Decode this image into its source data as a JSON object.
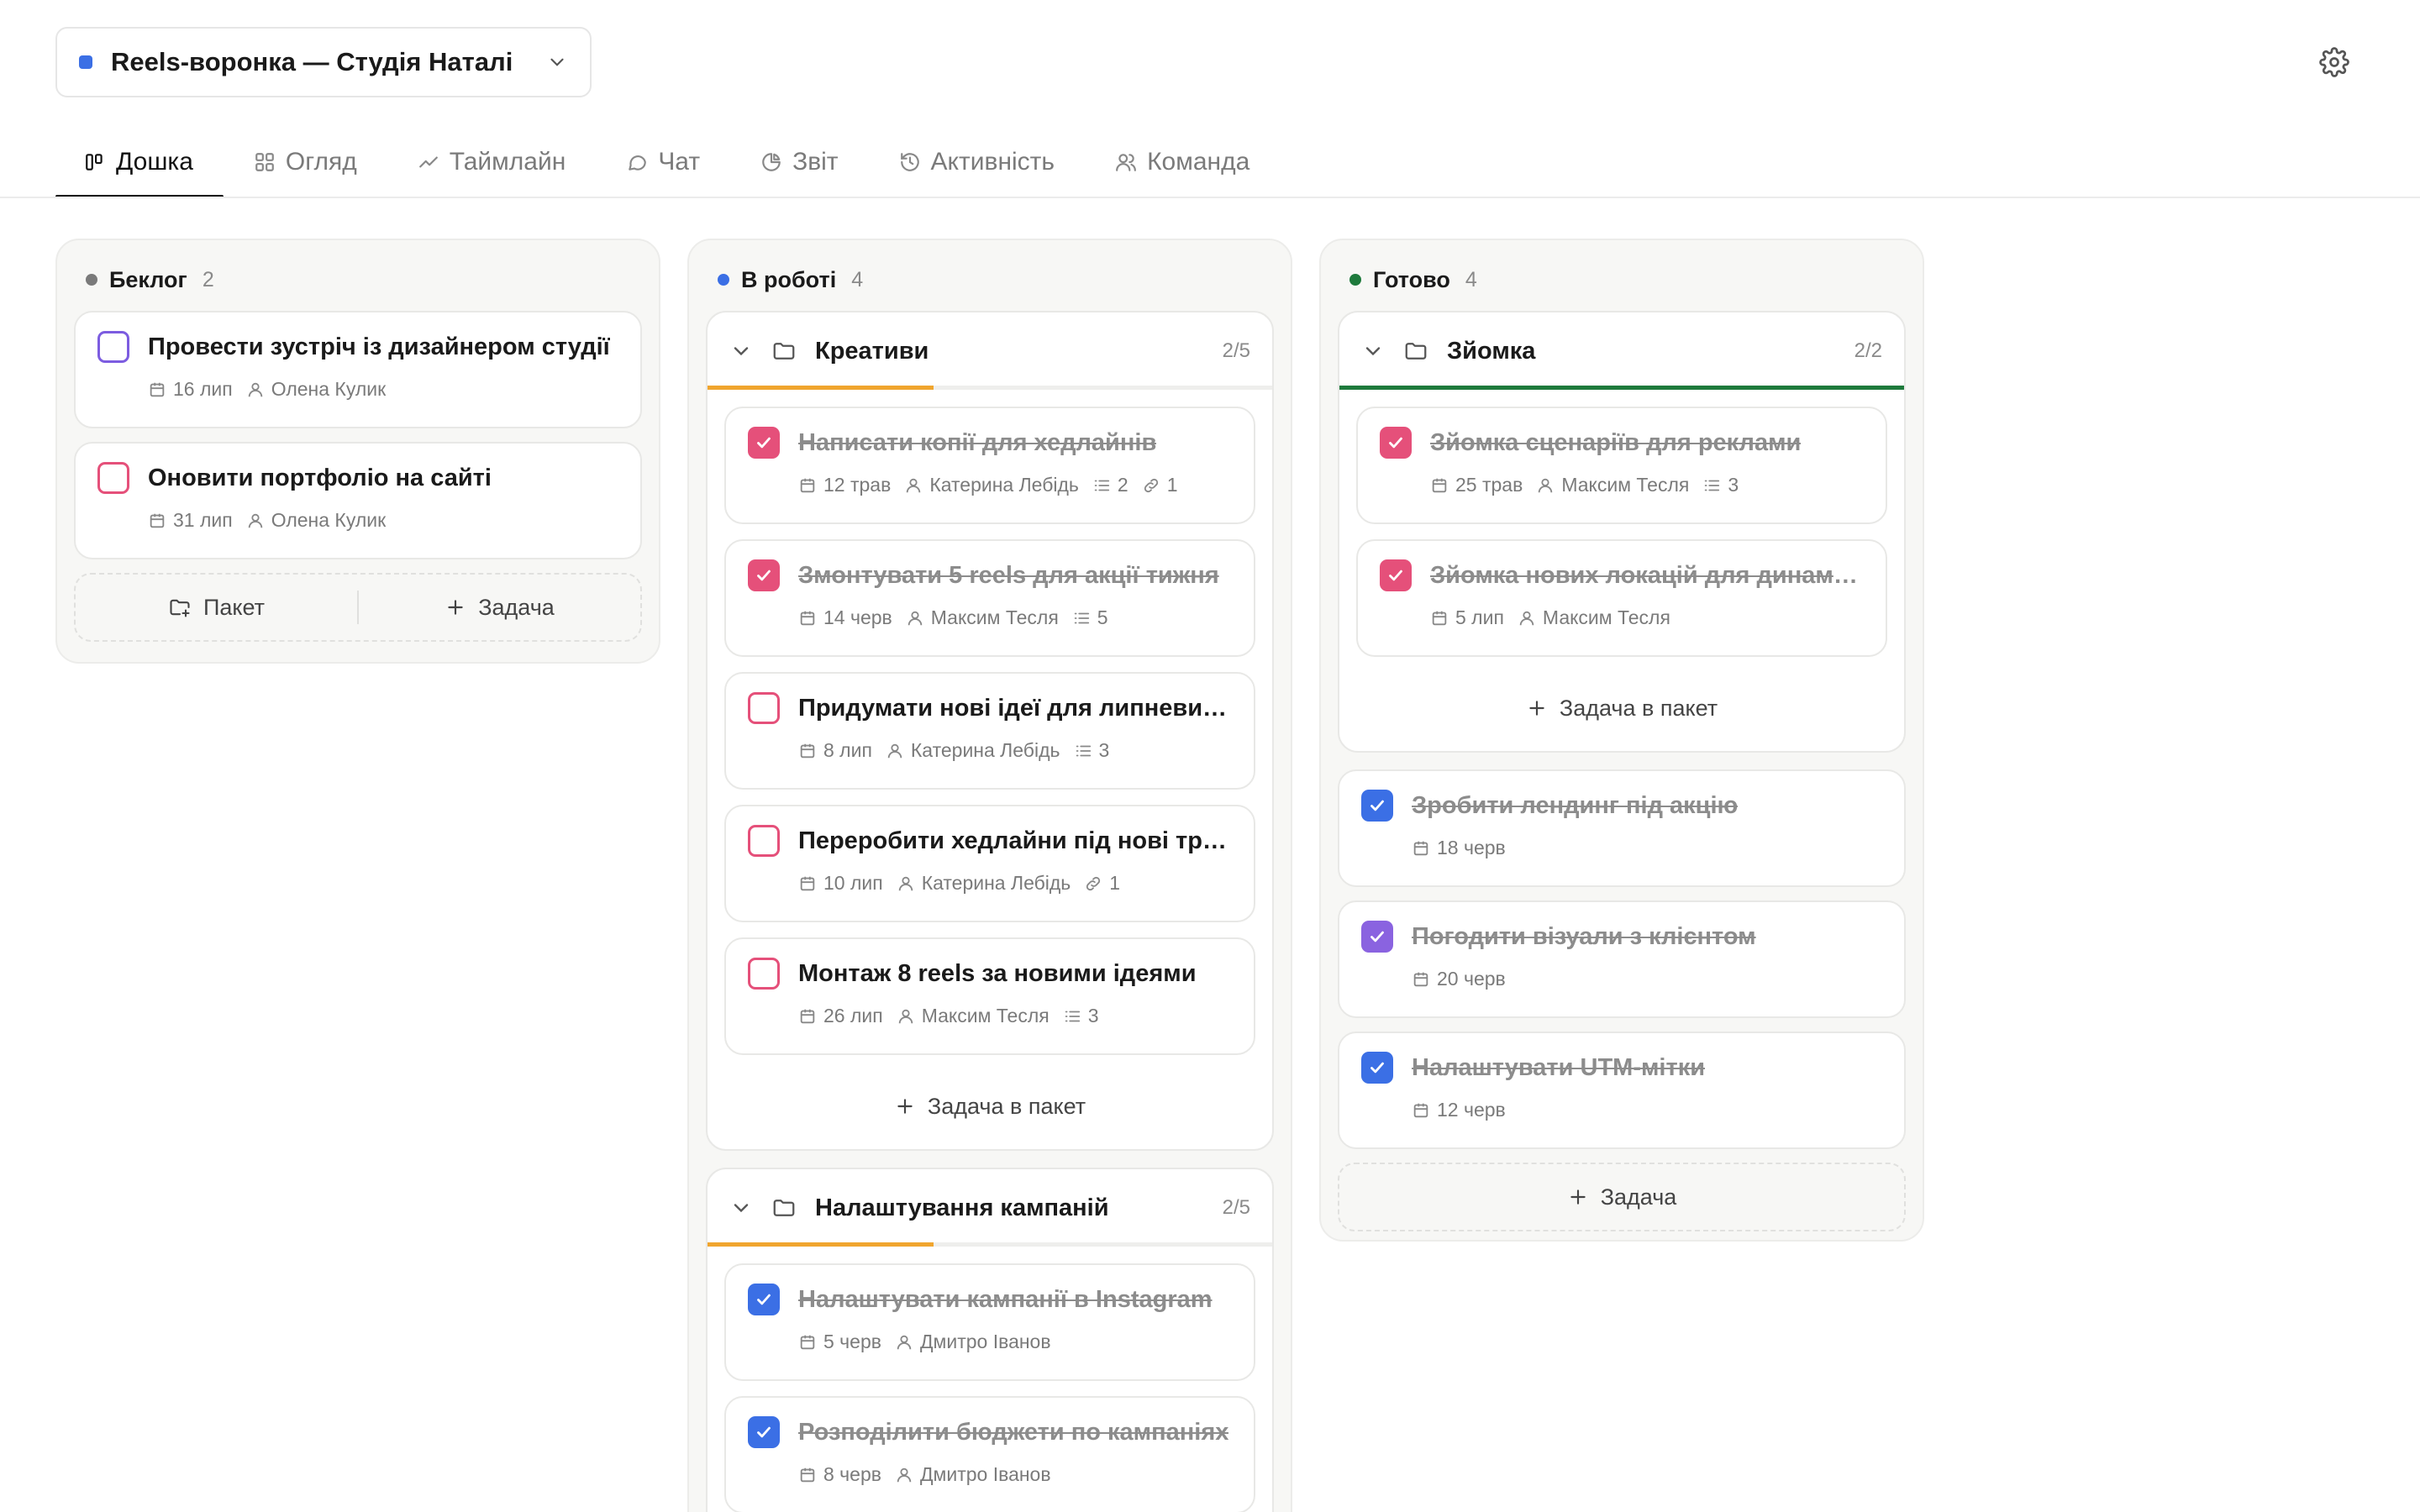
{
  "project": {
    "name": "Reels-воронка — Студія Наталі",
    "color": "#3b6fe5"
  },
  "tabs": [
    {
      "label": "Дошка",
      "icon": "board-icon",
      "active": true
    },
    {
      "label": "Огляд",
      "icon": "grid-icon"
    },
    {
      "label": "Таймлайн",
      "icon": "trend-icon"
    },
    {
      "label": "Чат",
      "icon": "chat-icon"
    },
    {
      "label": "Звіт",
      "icon": "pie-icon"
    },
    {
      "label": "Активність",
      "icon": "history-icon"
    },
    {
      "label": "Команда",
      "icon": "team-icon"
    }
  ],
  "columns": {
    "backlog": {
      "title": "Беклог",
      "count": "2",
      "color": "#7a7a7a",
      "cards": [
        {
          "title": "Провести зустріч із дизайнером студії",
          "date": "16 лип",
          "user": "Олена Кулик",
          "cb_color": "#7c5ce0",
          "done": false
        },
        {
          "title": "Оновити портфоліо на сайті",
          "date": "31 лип",
          "user": "Олена Кулик",
          "cb_color": "#e5507a",
          "done": false
        }
      ],
      "add_packet": "Пакет",
      "add_task": "Задача"
    },
    "in_progress": {
      "title": "В роботі",
      "count": "4",
      "color": "#3b6fe5",
      "packets": [
        {
          "title": "Креативи",
          "count": "2/5",
          "progress": 0.4,
          "bar_color": "#f0a52e",
          "cards": [
            {
              "title": "Написати копії для хедлайнів",
              "date": "12 трав",
              "user": "Катерина Лебідь",
              "subtasks": "2",
              "links": "1",
              "cb_color": "#e5507a",
              "done": true
            },
            {
              "title": "Змонтувати 5 reels для акції тижня",
              "date": "14 черв",
              "user": "Максим Тесля",
              "subtasks": "5",
              "cb_color": "#e5507a",
              "done": true
            },
            {
              "title": "Придумати нові ідеї для липневих ...",
              "date": "8 лип",
              "user": "Катерина Лебідь",
              "subtasks": "3",
              "cb_color": "#e5507a",
              "done": false
            },
            {
              "title": "Переробити хедлайни під нові тре...",
              "date": "10 лип",
              "user": "Катерина Лебідь",
              "links": "1",
              "cb_color": "#e5507a",
              "done": false
            },
            {
              "title": "Монтаж 8 reels за новими ідеями",
              "date": "26 лип",
              "user": "Максим Тесля",
              "subtasks": "3",
              "cb_color": "#e5507a",
              "done": false
            }
          ],
          "add_label": "Задача в пакет"
        },
        {
          "title": "Налаштування кампаній",
          "count": "2/5",
          "progress": 0.4,
          "bar_color": "#f0a52e",
          "cards": [
            {
              "title": "Налаштувати кампанії в Instagram",
              "date": "5 черв",
              "user": "Дмитро Іванов",
              "cb_color": "#3b6fe5",
              "done": true
            },
            {
              "title": "Розподілити бюджети по кампаніях",
              "date": "8 черв",
              "user": "Дмитро Іванов",
              "cb_color": "#3b6fe5",
              "done": true
            }
          ]
        }
      ]
    },
    "done": {
      "title": "Готово",
      "count": "4",
      "color": "#1e7a3c",
      "packet": {
        "title": "Зйомка",
        "count": "2/2",
        "progress": 1.0,
        "bar_color": "#1e7a3c",
        "cards": [
          {
            "title": "Зйомка сценаріїв для реклами",
            "date": "25 трав",
            "user": "Максим Тесля",
            "subtasks": "3",
            "cb_color": "#e5507a",
            "done": true
          },
          {
            "title": "Зйомка нових локацій для динаміки",
            "date": "5 лип",
            "user": "Максим Тесля",
            "cb_color": "#e5507a",
            "done": true
          }
        ],
        "add_label": "Задача в пакет"
      },
      "cards": [
        {
          "title": "Зробити лендинг під акцію",
          "date": "18 черв",
          "cb_color": "#3b6fe5",
          "done": true
        },
        {
          "title": "Погодити візуали з клієнтом",
          "date": "20 черв",
          "cb_color": "#8a63e0",
          "done": true
        },
        {
          "title": "Налаштувати UTM-мітки",
          "date": "12 черв",
          "cb_color": "#3b6fe5",
          "done": true
        }
      ],
      "add_task": "Задача"
    }
  }
}
